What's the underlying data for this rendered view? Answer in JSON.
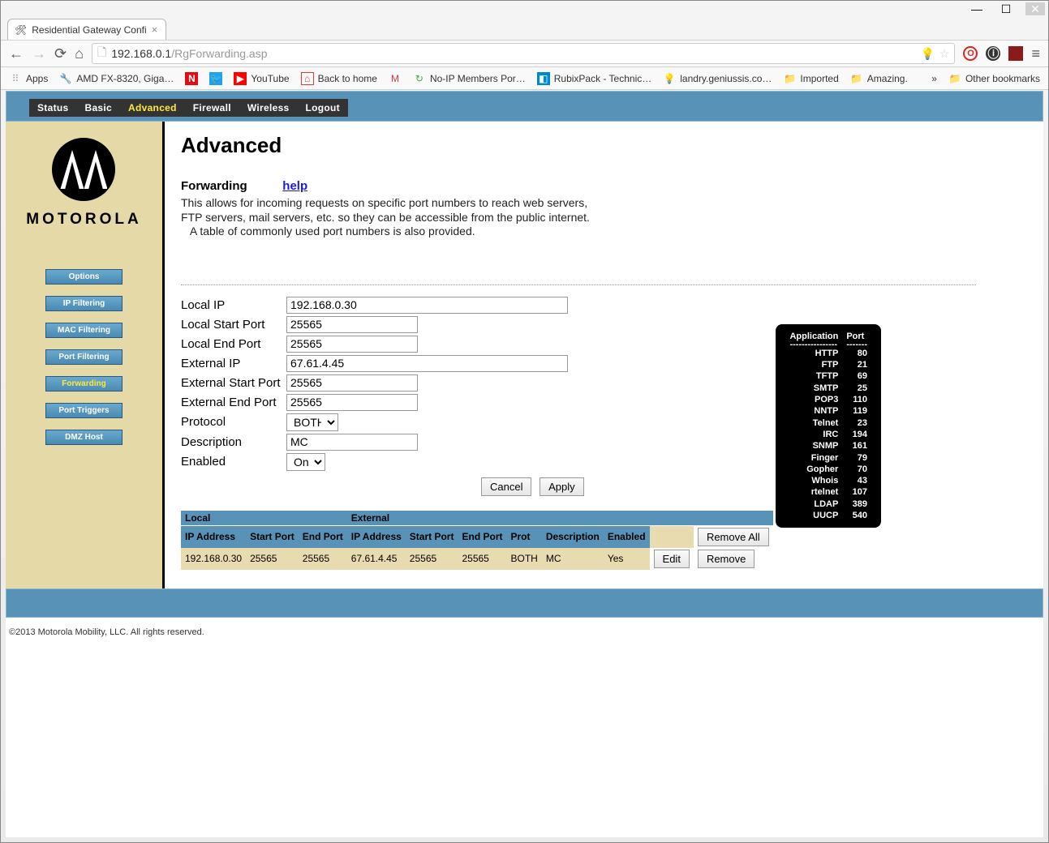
{
  "browser": {
    "tab_title": "Residential Gateway Confi",
    "url_origin": "192.168.0.1",
    "url_path": "/RgForwarding.asp",
    "bookmarks_label_apps": "Apps",
    "bookmarks": [
      "AMD FX-8320, Giga…",
      "N",
      "",
      "YouTube",
      "Back to home",
      "M",
      "No-IP Members Por…",
      "RubixPack - Technic…",
      "landry.geniussis.co…",
      "Imported",
      "Amazing."
    ],
    "other_bookmarks": "Other bookmarks",
    "overflow": "»"
  },
  "top_menu": [
    "Status",
    "Basic",
    "Advanced",
    "Firewall",
    "Wireless",
    "Logout"
  ],
  "top_menu_active": "Advanced",
  "sidebar": [
    "Options",
    "IP Filtering",
    "MAC Filtering",
    "Port Filtering",
    "Forwarding",
    "Port Triggers",
    "DMZ Host"
  ],
  "sidebar_active": "Forwarding",
  "logo_text": "MOTOROLA",
  "page": {
    "heading": "Advanced",
    "subheading": "Forwarding",
    "help": "help",
    "desc1": "This allows for incoming requests on specific port numbers to reach  web servers,",
    "desc2": "FTP servers, mail servers, etc. so they can be accessible from the public internet.",
    "desc3": "   A table of commonly used port numbers is also provided."
  },
  "form": {
    "labels": {
      "local_ip": "Local IP",
      "local_start": "Local Start Port",
      "local_end": "Local End Port",
      "ext_ip": "External IP",
      "ext_start": "External Start Port",
      "ext_end": "External End Port",
      "protocol": "Protocol",
      "description": "Description",
      "enabled": "Enabled"
    },
    "values": {
      "local_ip": "192.168.0.30",
      "local_start": "25565",
      "local_end": "25565",
      "ext_ip": "67.61.4.45",
      "ext_start": "25565",
      "ext_end": "25565",
      "protocol": "BOTH",
      "description": "MC",
      "enabled": "On"
    },
    "cancel": "Cancel",
    "apply": "Apply"
  },
  "table": {
    "group_local": "Local",
    "group_external": "External",
    "headers": [
      "IP Address",
      "Start Port",
      "End Port",
      "IP Address",
      "Start Port",
      "End Port",
      "Prot",
      "Description",
      "Enabled"
    ],
    "remove_all": "Remove All",
    "edit": "Edit",
    "remove": "Remove",
    "row": [
      "192.168.0.30",
      "25565",
      "25565",
      "67.61.4.45",
      "25565",
      "25565",
      "BOTH",
      "MC",
      "Yes"
    ]
  },
  "ports": {
    "head_app": "Application",
    "head_port": "Port",
    "rows": [
      [
        "HTTP",
        "80"
      ],
      [
        "FTP",
        "21"
      ],
      [
        "TFTP",
        "69"
      ],
      [
        "SMTP",
        "25"
      ],
      [
        "POP3",
        "110"
      ],
      [
        "NNTP",
        "119"
      ],
      [
        "Telnet",
        "23"
      ],
      [
        "IRC",
        "194"
      ],
      [
        "SNMP",
        "161"
      ],
      [
        "Finger",
        "79"
      ],
      [
        "Gopher",
        "70"
      ],
      [
        "Whois",
        "43"
      ],
      [
        "rtelnet",
        "107"
      ],
      [
        "LDAP",
        "389"
      ],
      [
        "UUCP",
        "540"
      ]
    ]
  },
  "copyright": "©2013 Motorola Mobility, LLC. All rights reserved."
}
